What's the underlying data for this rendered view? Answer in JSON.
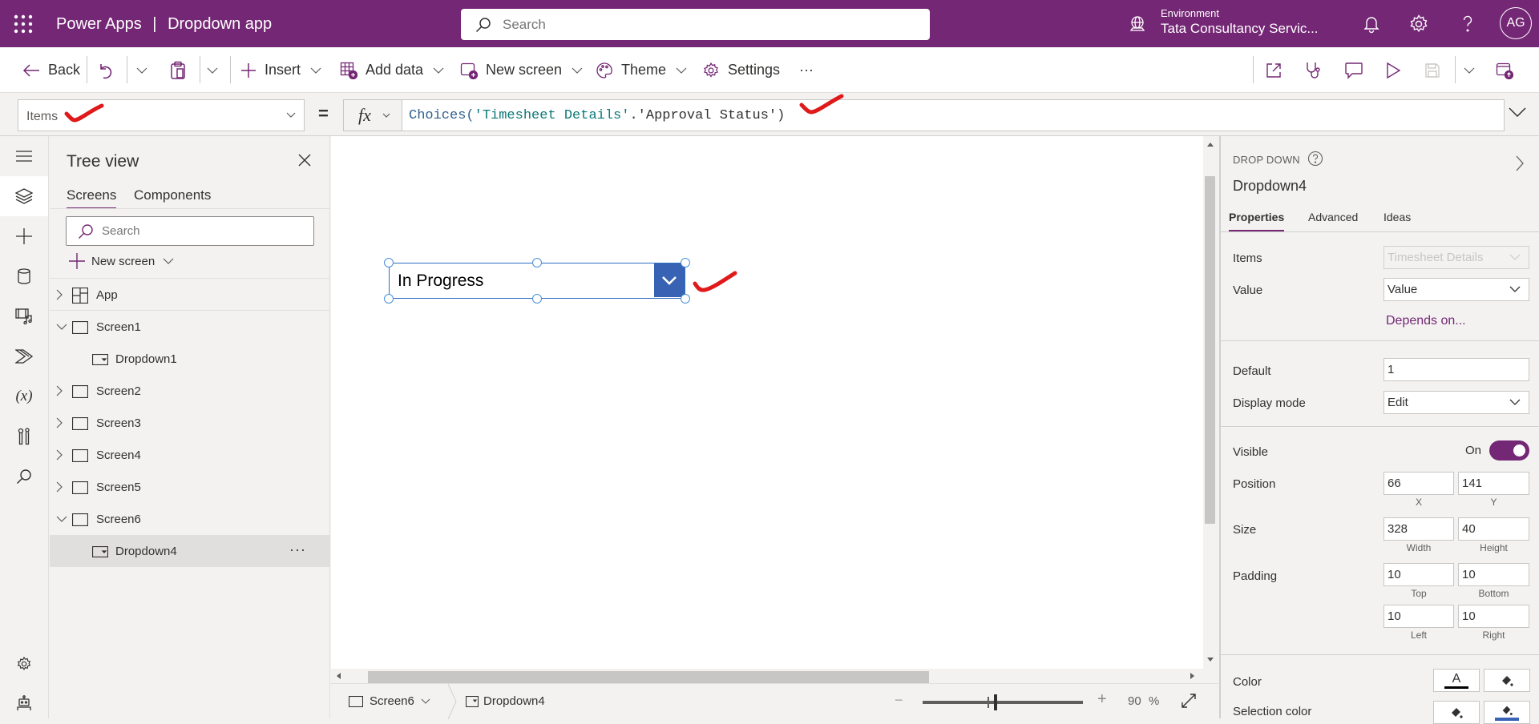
{
  "topbar": {
    "app_name": "Power Apps",
    "separator": "|",
    "app_title": "Dropdown app",
    "search_placeholder": "Search",
    "environment_label": "Environment",
    "environment_name": "Tata Consultancy Servic...",
    "avatar_initials": "AG",
    "brand_color": "#742774"
  },
  "commandbar": {
    "back": "Back",
    "insert": "Insert",
    "add_data": "Add data",
    "new_screen": "New screen",
    "theme": "Theme",
    "settings": "Settings",
    "more": "···"
  },
  "formulabar": {
    "property": "Items",
    "equals": "=",
    "fx": "fx",
    "formula_fn": "Choices(",
    "formula_arg1": "'Timesheet Details'",
    "formula_dot": ".",
    "formula_arg2": "'Approval Status'",
    "formula_close": ")"
  },
  "tree": {
    "title": "Tree view",
    "tabs": [
      "Screens",
      "Components"
    ],
    "active_tab": "Screens",
    "search_placeholder": "Search",
    "new_screen": "New screen",
    "items": [
      {
        "label": "App",
        "type": "app",
        "expanded": false,
        "level": 0
      },
      {
        "label": "Screen1",
        "type": "screen",
        "expanded": true,
        "level": 0
      },
      {
        "label": "Dropdown1",
        "type": "dropdown",
        "level": 1
      },
      {
        "label": "Screen2",
        "type": "screen",
        "expanded": false,
        "level": 0
      },
      {
        "label": "Screen3",
        "type": "screen",
        "expanded": false,
        "level": 0
      },
      {
        "label": "Screen4",
        "type": "screen",
        "expanded": false,
        "level": 0
      },
      {
        "label": "Screen5",
        "type": "screen",
        "expanded": false,
        "level": 0
      },
      {
        "label": "Screen6",
        "type": "screen",
        "expanded": true,
        "level": 0
      },
      {
        "label": "Dropdown4",
        "type": "dropdown",
        "level": 1,
        "selected": true
      }
    ],
    "more": "···"
  },
  "canvas": {
    "dropdown_value": "In Progress",
    "dropdown_button_color": "#3863b4"
  },
  "statusbar": {
    "screen": "Screen6",
    "control": "Dropdown4",
    "zoom_minus": "−",
    "zoom_plus": "+",
    "zoom_value": "90",
    "zoom_unit": "%"
  },
  "props": {
    "type_label": "DROP DOWN",
    "control_name": "Dropdown4",
    "tabs": [
      "Properties",
      "Advanced",
      "Ideas"
    ],
    "active_tab": "Properties",
    "items_label": "Items",
    "items_value": "Timesheet Details",
    "value_label": "Value",
    "value_value": "Value",
    "depends_on": "Depends on...",
    "default_label": "Default",
    "default_value": "1",
    "display_mode_label": "Display mode",
    "display_mode_value": "Edit",
    "visible_label": "Visible",
    "visible_state": "On",
    "visible_on": true,
    "position_label": "Position",
    "position_x": "66",
    "position_y": "141",
    "x_label": "X",
    "y_label": "Y",
    "size_label": "Size",
    "size_width": "328",
    "size_height": "40",
    "width_label": "Width",
    "height_label": "Height",
    "padding_label": "Padding",
    "padding_top": "10",
    "padding_bottom": "10",
    "padding_left": "10",
    "padding_right": "10",
    "top_label": "Top",
    "bottom_label": "Bottom",
    "left_label": "Left",
    "right_label": "Right",
    "color_label": "Color",
    "selection_color_label": "Selection color",
    "text_color_glyph": "A",
    "selection_fill_color": "#3863b4"
  }
}
